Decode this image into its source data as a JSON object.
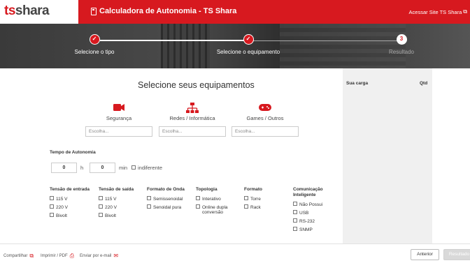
{
  "header": {
    "logo_ts": "ts",
    "logo_shara": "shara",
    "title": "Calculadora de Autonomia - TS Shara",
    "site_link": "Acessar Site TS Shara"
  },
  "steps": [
    {
      "label": "Selecione o tipo",
      "marker": "✓"
    },
    {
      "label": "Selecione o equipamento",
      "marker": "✓"
    },
    {
      "label": "Resultado",
      "marker": "3"
    }
  ],
  "main": {
    "title": "Selecione seus equipamentos",
    "categories": [
      {
        "label": "Segurança",
        "icon": "camera-icon",
        "placeholder": "Escolha..."
      },
      {
        "label": "Redes / Informática",
        "icon": "network-icon",
        "placeholder": "Escolha..."
      },
      {
        "label": "Games / Outros",
        "icon": "gamepad-icon",
        "placeholder": "Escolha..."
      }
    ],
    "autonomy": {
      "title": "Tempo de Autonomia",
      "hours_value": "0",
      "hours_unit": "h",
      "minutes_value": "0",
      "minutes_unit": "min",
      "indifferent_label": "indiferente"
    },
    "filters": [
      {
        "title": "Tensão de entrada",
        "options": [
          "115 V",
          "220 V",
          "Bivolt"
        ]
      },
      {
        "title": "Tensão de saída",
        "options": [
          "115 V",
          "220 V",
          "Bivolt"
        ]
      },
      {
        "title": "Formato de Onda",
        "options": [
          "Semissenoidal",
          "Senoidal pura"
        ]
      },
      {
        "title": "Topologia",
        "options": [
          "Interativo",
          "Online dupla conversão"
        ]
      },
      {
        "title": "Formato",
        "options": [
          "Torre",
          "Rack"
        ]
      },
      {
        "title": "Comunicação Inteligente",
        "options": [
          "Não Possui",
          "USB",
          "RS-232",
          "SNMP"
        ]
      }
    ]
  },
  "sidebar": {
    "load_header": "Sua carga",
    "qty_header": "Qtd"
  },
  "footer": {
    "share": "Compartilhar",
    "print": "Imprimir / PDF",
    "email": "Enviar por e-mail",
    "back": "Anterior",
    "next": "Resultado"
  },
  "colors": {
    "accent": "#d7191f"
  }
}
